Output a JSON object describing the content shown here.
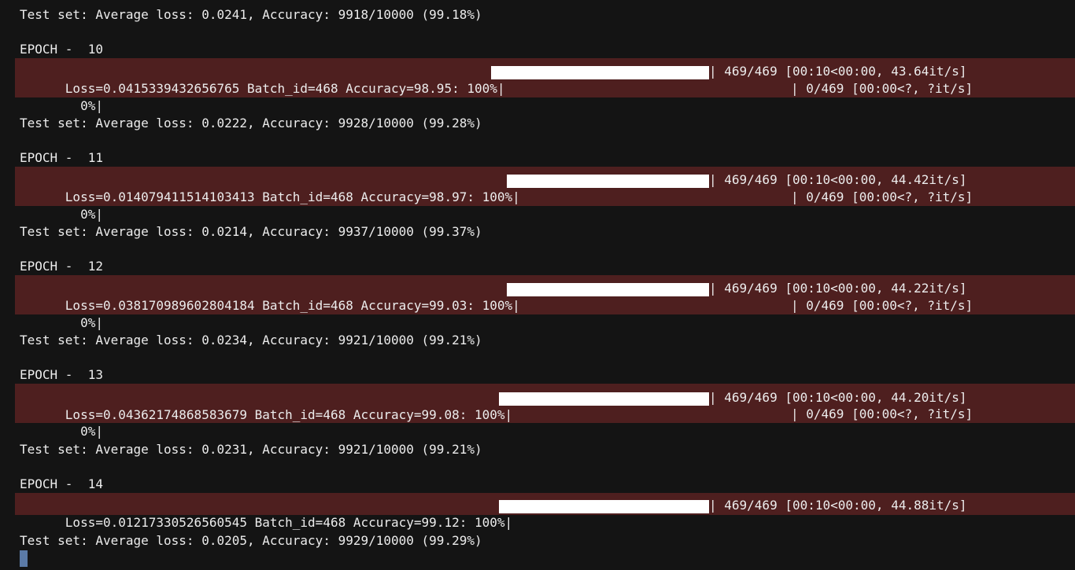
{
  "lines": {
    "test_0": "Test set: Average loss: 0.0241, Accuracy: 9918/10000 (99.18%)",
    "epoch_10": "EPOCH -  10",
    "test_10": "Test set: Average loss: 0.0222, Accuracy: 9928/10000 (99.28%)",
    "epoch_11": "EPOCH -  11",
    "test_11": "Test set: Average loss: 0.0214, Accuracy: 9937/10000 (99.37%)",
    "epoch_12": "EPOCH -  12",
    "test_12": "Test set: Average loss: 0.0234, Accuracy: 9921/10000 (99.21%)",
    "epoch_13": "EPOCH -  13",
    "test_13": "Test set: Average loss: 0.0231, Accuracy: 9921/10000 (99.21%)",
    "epoch_14": "EPOCH -  14",
    "test_14": "Test set: Average loss: 0.0205, Accuracy: 9929/10000 (99.29%)"
  },
  "progress": {
    "e10": {
      "desc": "Loss=0.0415339432656765 Batch_id=468 Accuracy=98.95: 100%|",
      "stats": "| 469/469 [00:10<00:00, 43.64it/s]",
      "next_pct": "  0%|",
      "next_stats": "| 0/469 [00:00<?, ?it/s]",
      "fraction": 1.0
    },
    "e11": {
      "desc": "Loss=0.014079411514103413 Batch_id=468 Accuracy=98.97: 100%|",
      "stats": "| 469/469 [00:10<00:00, 44.42it/s]",
      "next_pct": "  0%|",
      "next_stats": "| 0/469 [00:00<?, ?it/s]",
      "fraction": 1.0
    },
    "e12": {
      "desc": "Loss=0.038170989602804184 Batch_id=468 Accuracy=99.03: 100%|",
      "stats": "| 469/469 [00:10<00:00, 44.22it/s]",
      "next_pct": "  0%|",
      "next_stats": "| 0/469 [00:00<?, ?it/s]",
      "fraction": 1.0
    },
    "e13": {
      "desc": "Loss=0.04362174868583679 Batch_id=468 Accuracy=99.08: 100%|",
      "stats": "| 469/469 [00:10<00:00, 44.20it/s]",
      "next_pct": "  0%|",
      "next_stats": "| 0/469 [00:00<?, ?it/s]",
      "fraction": 1.0
    },
    "e14": {
      "desc": "Loss=0.01217330526560545 Batch_id=468 Accuracy=99.12: 100%|",
      "stats": "| 469/469 [00:10<00:00, 44.88it/s]",
      "fraction": 1.0
    }
  },
  "colors": {
    "background": "#141414",
    "stderr_block": "#4e1f1f",
    "bar_fill": "#ffffff",
    "cursor": "#5b7aa6",
    "text": "#ececec"
  }
}
